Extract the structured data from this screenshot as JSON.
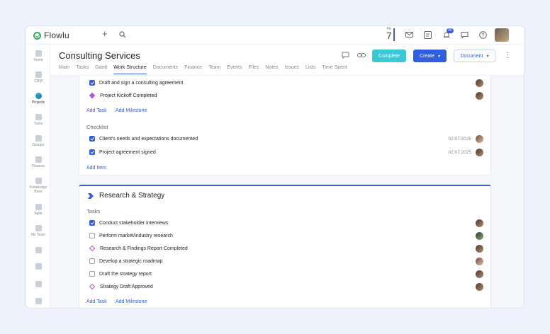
{
  "app": {
    "name": "Flowlu"
  },
  "topbar": {
    "date_day": "Fri",
    "date_num": "7",
    "notif_count": "30"
  },
  "sidebar": {
    "items": [
      {
        "label": "Home",
        "icon": "home-icon"
      },
      {
        "label": "CRM",
        "icon": "crm-icon"
      },
      {
        "label": "Projects",
        "icon": "projects-icon",
        "active": true
      },
      {
        "label": "Tasks",
        "icon": "tasks-icon"
      },
      {
        "label": "Groups",
        "icon": "groups-icon"
      },
      {
        "label": "Finance",
        "icon": "finance-icon"
      },
      {
        "label": "Knowledge Base",
        "icon": "knowledge-base-icon"
      },
      {
        "label": "Agile",
        "icon": "agile-icon"
      },
      {
        "label": "My Team",
        "icon": "my-team-icon"
      }
    ]
  },
  "project": {
    "title": "Consulting Services",
    "buttons": {
      "complete": "Complete",
      "create": "Create",
      "document": "Document"
    },
    "tabs": [
      "Main",
      "Tasks",
      "Gantt",
      "Work Structure",
      "Documents",
      "Finance",
      "Team",
      "Events",
      "Files",
      "Notes",
      "Issues",
      "Lists",
      "Time Spent"
    ],
    "active_tab": "Work Structure"
  },
  "card1": {
    "tasks": [
      {
        "text": "Draft and sign a consulting agreement",
        "type": "checkbox",
        "checked": true
      },
      {
        "text": "Project Kickoff Completed",
        "type": "milestone",
        "filled": true
      }
    ],
    "add_task": "Add Task",
    "add_milestone": "Add Milestone",
    "checklist_label": "Checklist",
    "checklist": [
      {
        "text": "Client's needs and expectations documented",
        "date": "02.07.2025"
      },
      {
        "text": "Project agreement signed",
        "date": "02.07.2025"
      }
    ],
    "add_item": "Add Item"
  },
  "card2": {
    "title": "Research & Strategy",
    "tasks_label": "Tasks",
    "tasks": [
      {
        "text": "Conduct stakeholder interviews",
        "type": "checkbox",
        "checked": true
      },
      {
        "text": "Perform market/industry research",
        "type": "checkbox",
        "checked": false
      },
      {
        "text": "Research & Findings Report Completed",
        "type": "milestone",
        "filled": false
      },
      {
        "text": "Develop a strategic roadmap",
        "type": "checkbox",
        "checked": false
      },
      {
        "text": "Draft the strategy report",
        "type": "checkbox",
        "checked": false
      },
      {
        "text": "Strategy Draft Approved",
        "type": "milestone",
        "filled": false
      }
    ],
    "add_task": "Add Task",
    "add_milestone": "Add Milestone"
  }
}
